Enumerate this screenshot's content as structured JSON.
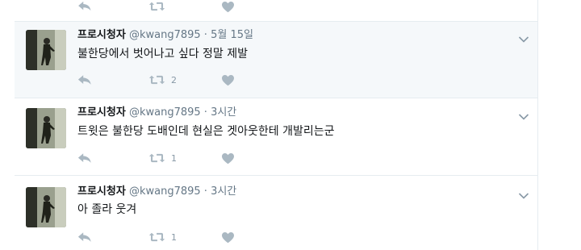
{
  "colors": {
    "icon": "#aab8c2",
    "highlight_bg": "#f5f8fa",
    "border": "#e6ecf0",
    "secondary_text": "#657786"
  },
  "icons": {
    "reply": "reply-icon",
    "retweet": "retweet-icon",
    "like": "heart-icon",
    "menu": "chevron-down-icon",
    "avatar": "profile-avatar"
  },
  "tweets": [
    {
      "name": "프로시청자",
      "handle": "@kwang7895",
      "separator": "·",
      "time": "5월 15일",
      "text": "불한당에서 벗어나고 싶다 정말 제발",
      "retweets": "2",
      "highlighted": true
    },
    {
      "name": "프로시청자",
      "handle": "@kwang7895",
      "separator": "·",
      "time": "3시간",
      "text": "트윗은 불한당 도배인데 현실은 겟아웃한테 개발리는군",
      "retweets": "1",
      "highlighted": false
    },
    {
      "name": "프로시청자",
      "handle": "@kwang7895",
      "separator": "·",
      "time": "3시간",
      "text": "아 졸라 웃겨",
      "retweets": "1",
      "highlighted": false
    }
  ]
}
